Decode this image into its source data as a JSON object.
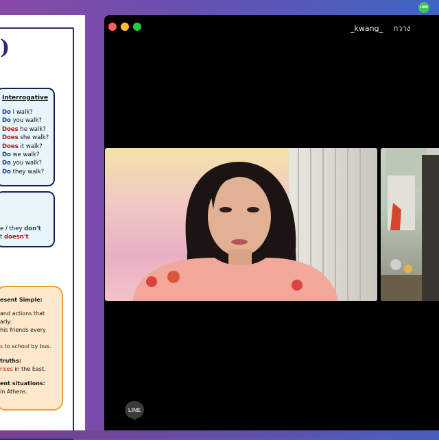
{
  "topbar": {
    "line_badge": "LINE"
  },
  "slide": {
    "title": ")",
    "interrogative": {
      "title": "Interrogative",
      "items": [
        {
          "aux": "Do",
          "rest": " I walk?"
        },
        {
          "aux": "Do",
          "rest": " you walk?"
        },
        {
          "aux": "Does",
          "rest": " he walk?"
        },
        {
          "aux": "Does",
          "rest": " she walk?"
        },
        {
          "aux": "Does",
          "rest": " it walk?"
        },
        {
          "aux": "Do",
          "rest": " we walk?"
        },
        {
          "aux": "Do",
          "rest": " you walk?"
        },
        {
          "aux": "Do",
          "rest": " they walk?"
        }
      ]
    },
    "negative": {
      "line1_pre": "e / they ",
      "line1_aux": "don't",
      "line2_pre": "t ",
      "line2_aux": "doesn't"
    },
    "uses": {
      "heading": "esent Simple:",
      "l1": "and actions that",
      "l2": "arly:",
      "l3": "his friends every",
      "l4_red": "s",
      "l4": " to school by bus.",
      "l5": " truths:",
      "l6_red": "rises",
      "l6": " in the East.",
      "l7": "ent situations:",
      "l8": "in Athens."
    }
  },
  "window": {
    "participant_names": [
      "_kwang_",
      "กวาง"
    ]
  },
  "footer": {
    "line_logo": "LINE"
  },
  "colors": {
    "do_blue": "#1a2fa8",
    "does_red": "#b3121a",
    "line_green": "#3fc25a"
  }
}
